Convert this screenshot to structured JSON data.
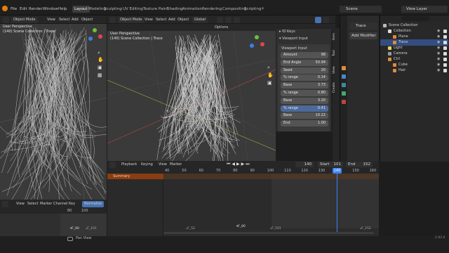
{
  "topbar": {
    "menus": [
      "File",
      "Edit",
      "Render",
      "Window",
      "Help"
    ],
    "workspaces": [
      "Layout",
      "Modeling",
      "Sculpting",
      "UV Editing",
      "Texture Paint",
      "Shading",
      "Animation",
      "Rendering",
      "Compositing",
      "Scripting"
    ],
    "active_workspace": "Layout",
    "scene": "Scene",
    "view_layer": "View Layer"
  },
  "left_viewport": {
    "mode": "Object Mode",
    "menu": [
      "View",
      "Select",
      "Add",
      "Object"
    ],
    "overlay_title": "User Perspective",
    "overlay_sub": "(140) Scene Collection | Trace"
  },
  "main_viewport": {
    "mode": "Object Mode",
    "menu": [
      "View",
      "Select",
      "Add",
      "Object"
    ],
    "orientation": "Global",
    "options_label": "Options",
    "overlay_title": "User Perspective",
    "overlay_sub": "(140) Scene Collection | Trace"
  },
  "npanel": {
    "sections": {
      "id_keys": "ID Keys",
      "viewport_input": "Viewport Input"
    },
    "title": "Viewport Input",
    "rows": [
      {
        "k": "Amount",
        "v": "98"
      },
      {
        "k": "End Angle",
        "v": "50.94"
      },
      {
        "k": "Seed",
        "v": "20"
      },
      {
        "k": "% range",
        "v": "0.14"
      },
      {
        "k": "Base",
        "v": "3.73"
      },
      {
        "k": "% range",
        "v": "0.80"
      },
      {
        "k": "Base",
        "v": "3.20"
      },
      {
        "k": "% range",
        "v": "0.41"
      },
      {
        "k": "Base",
        "v": "10.22"
      },
      {
        "k": "End",
        "v": "1.00"
      }
    ],
    "tabs": [
      "Item",
      "Tool",
      "View",
      "Create"
    ]
  },
  "properties": {
    "object_name": "Trace",
    "add_modifier": "Add Modifier"
  },
  "outliner": {
    "items": [
      {
        "label": "Scene Collection",
        "indent": 0
      },
      {
        "label": "Collection",
        "indent": 1
      },
      {
        "label": "Plane",
        "indent": 2
      },
      {
        "label": "Trace",
        "indent": 2
      },
      {
        "label": "Light",
        "indent": 1
      },
      {
        "label": "Camera",
        "indent": 1
      },
      {
        "label": "Ctrl",
        "indent": 1
      },
      {
        "label": "Cube",
        "indent": 2
      },
      {
        "label": "Hair",
        "indent": 2
      }
    ]
  },
  "dopesheet": {
    "menu": [
      "Playback",
      "Keying",
      "View",
      "Marker"
    ],
    "current_frame": "140",
    "start_label": "Start",
    "start": "101",
    "end_label": "End",
    "end": "152",
    "summary": "Summary",
    "ticks": [
      "40",
      "50",
      "60",
      "70",
      "80",
      "90",
      "100",
      "110",
      "120",
      "130",
      "140",
      "150",
      "160"
    ],
    "markers": [
      "F_52",
      "F_80",
      "F_101",
      "F_152"
    ]
  },
  "graph_editor": {
    "menu": [
      "View",
      "Select",
      "Marker",
      "Channel",
      "Key"
    ],
    "normalize": "Normalize",
    "ticks": [
      "80",
      "100"
    ],
    "markers": [
      "F_80",
      "F_101"
    ]
  },
  "statusbar": {
    "pan_view": "Pan View",
    "version": "2.83.0"
  },
  "colors": {
    "accent": "#4772b3",
    "playhead": "#3d84ff",
    "summary_bar": "#8a3d10",
    "viewport_bg": "#3a3a3a",
    "text": "#d4d4d4"
  }
}
